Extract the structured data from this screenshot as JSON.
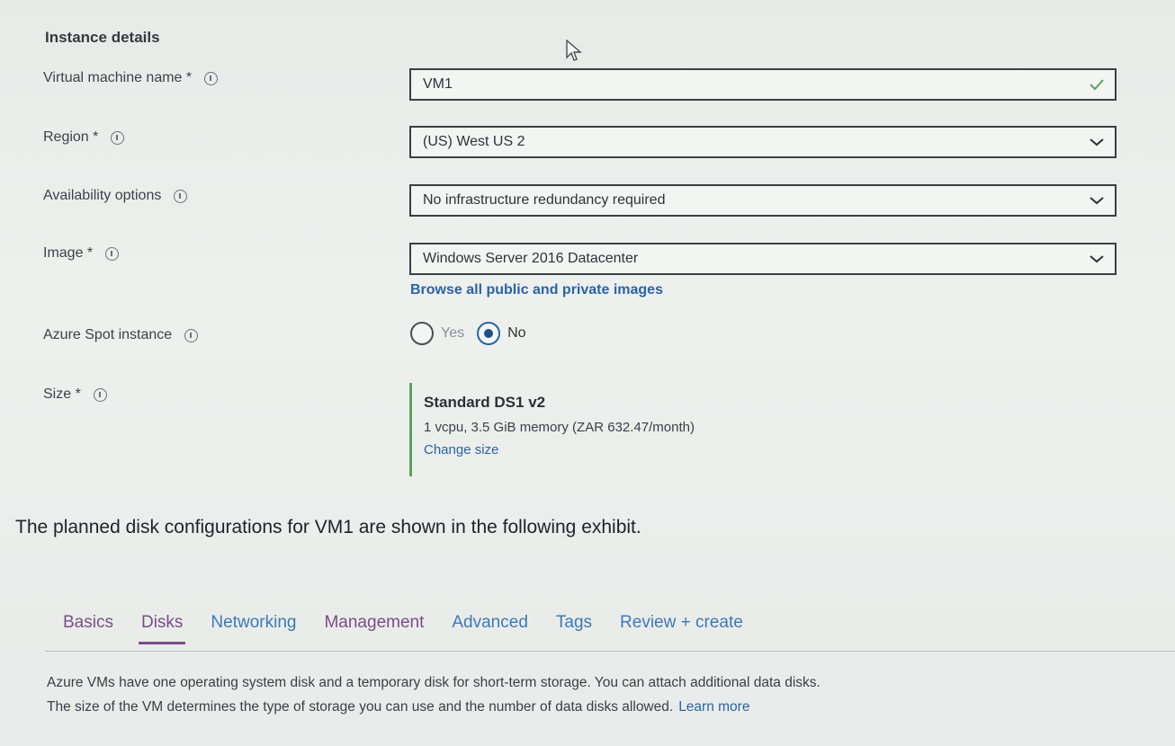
{
  "instance_details": {
    "title": "Instance details",
    "vm_name": {
      "label": "Virtual machine name *",
      "value": "VM1"
    },
    "region": {
      "label": "Region *",
      "value": "(US) West US 2"
    },
    "availability": {
      "label": "Availability options",
      "value": "No infrastructure redundancy required"
    },
    "image": {
      "label": "Image *",
      "value": "Windows Server 2016 Datacenter",
      "browse_link": "Browse all public and private images"
    },
    "spot": {
      "label": "Azure Spot instance",
      "options": [
        "Yes",
        "No"
      ],
      "selected": "No"
    },
    "size": {
      "label": "Size *",
      "name": "Standard DS1 v2",
      "details": "1 vcpu, 3.5 GiB memory (ZAR 632.47/month)",
      "change_link": "Change size"
    }
  },
  "exhibit_text": "The planned disk configurations for VM1 are shown in the following exhibit.",
  "tabs": [
    "Basics",
    "Disks",
    "Networking",
    "Management",
    "Advanced",
    "Tags",
    "Review + create"
  ],
  "active_tab": "Disks",
  "disks_description": {
    "line1": "Azure VMs have one operating system disk and a temporary disk for short-term storage. You can attach additional data disks.",
    "line2": "The size of the VM determines the type of storage you can use and the number of data disks allowed.",
    "learn_more": "Learn more"
  },
  "colors": {
    "link": "#2a63a6",
    "visited": "#7a4d86",
    "valid_check": "#5aa35a"
  }
}
